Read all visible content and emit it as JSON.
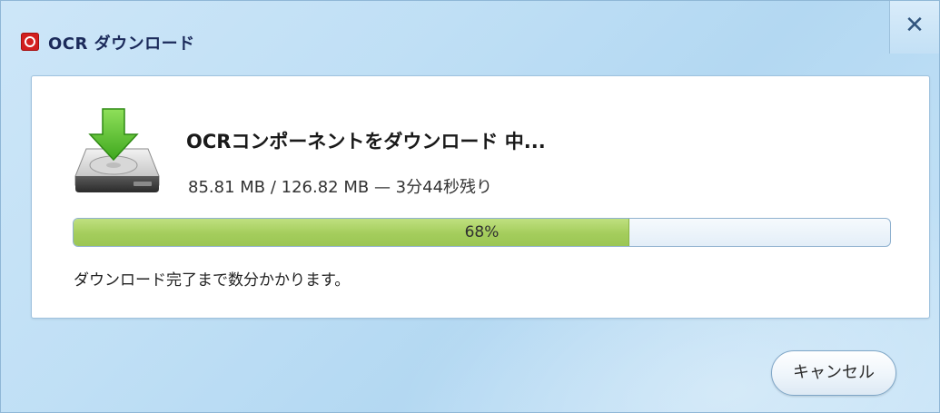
{
  "window": {
    "title": "OCR ダウンロード",
    "close_label": "✕"
  },
  "download": {
    "heading": "OCRコンポーネントをダウンロード 中...",
    "size_info": "85.81 MB / 126.82 MB — 3分44秒残り",
    "progress_percent": 68,
    "progress_label": "68%",
    "note": "ダウンロード完了まで数分かかります。",
    "icon": "hdd-download-icon"
  },
  "buttons": {
    "cancel_label": "キャンセル"
  },
  "colors": {
    "progress_fill": "#a4cd5c",
    "app_icon": "#d21f1f"
  }
}
